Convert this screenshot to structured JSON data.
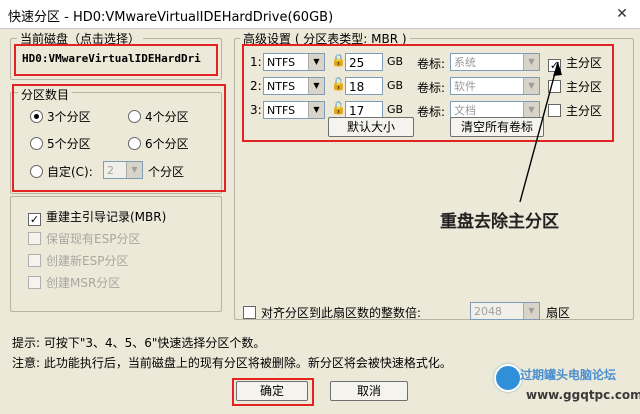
{
  "window": {
    "title": "快速分区 - HD0:VMwareVirtualIDEHardDrive(60GB)",
    "close_glyph": "✕"
  },
  "current_disk": {
    "label": "当前磁盘（点击选择）",
    "value": "HD0:VMwareVirtualIDEHardDri"
  },
  "partition_count": {
    "label": "分区数目",
    "options": [
      "3个分区",
      "4个分区",
      "5个分区",
      "6个分区"
    ],
    "selected": "3个分区",
    "custom_label": "自定(C):",
    "custom_value": "2",
    "custom_suffix": "个分区"
  },
  "options": {
    "rebuild_mbr": "重建主引导记录(MBR)",
    "keep_esp": "保留现有ESP分区",
    "create_esp": "创建新ESP分区",
    "create_msr": "创建MSR分区"
  },
  "advanced": {
    "label": "高级设置 ( 分区表类型: MBR )",
    "rows": [
      {
        "index": "1:",
        "fs": "NTFS",
        "size": "25",
        "unit": "GB",
        "vol_label": "卷标:",
        "vol": "系统",
        "primary_label": "主分区",
        "primary": true
      },
      {
        "index": "2:",
        "fs": "NTFS",
        "size": "18",
        "unit": "GB",
        "vol_label": "卷标:",
        "vol": "软件",
        "primary_label": "主分区",
        "primary": false
      },
      {
        "index": "3:",
        "fs": "NTFS",
        "size": "17",
        "unit": "GB",
        "vol_label": "卷标:",
        "vol": "文档",
        "primary_label": "主分区",
        "primary": false
      }
    ],
    "default_size_btn": "默认大小",
    "clear_labels_btn": "清空所有卷标"
  },
  "annotation": "重盘去除主分区",
  "align": {
    "label": "对齐分区到此扇区数的整数倍:",
    "value": "2048",
    "unit": "扇区"
  },
  "hints": {
    "line1": "提示: 可按下\"3、4、5、6\"快速选择分区个数。",
    "line2": "注意: 此功能执行后，当前磁盘上的现有分区将被删除。新分区将会被快速格式化。"
  },
  "buttons": {
    "ok": "确定",
    "cancel": "取消"
  },
  "watermark": {
    "text": "过期罐头电脑论坛",
    "url": "www.ggqtpc.com"
  },
  "colors": {
    "highlight": "#e32320",
    "dialog_bg": "#ece9d8"
  }
}
